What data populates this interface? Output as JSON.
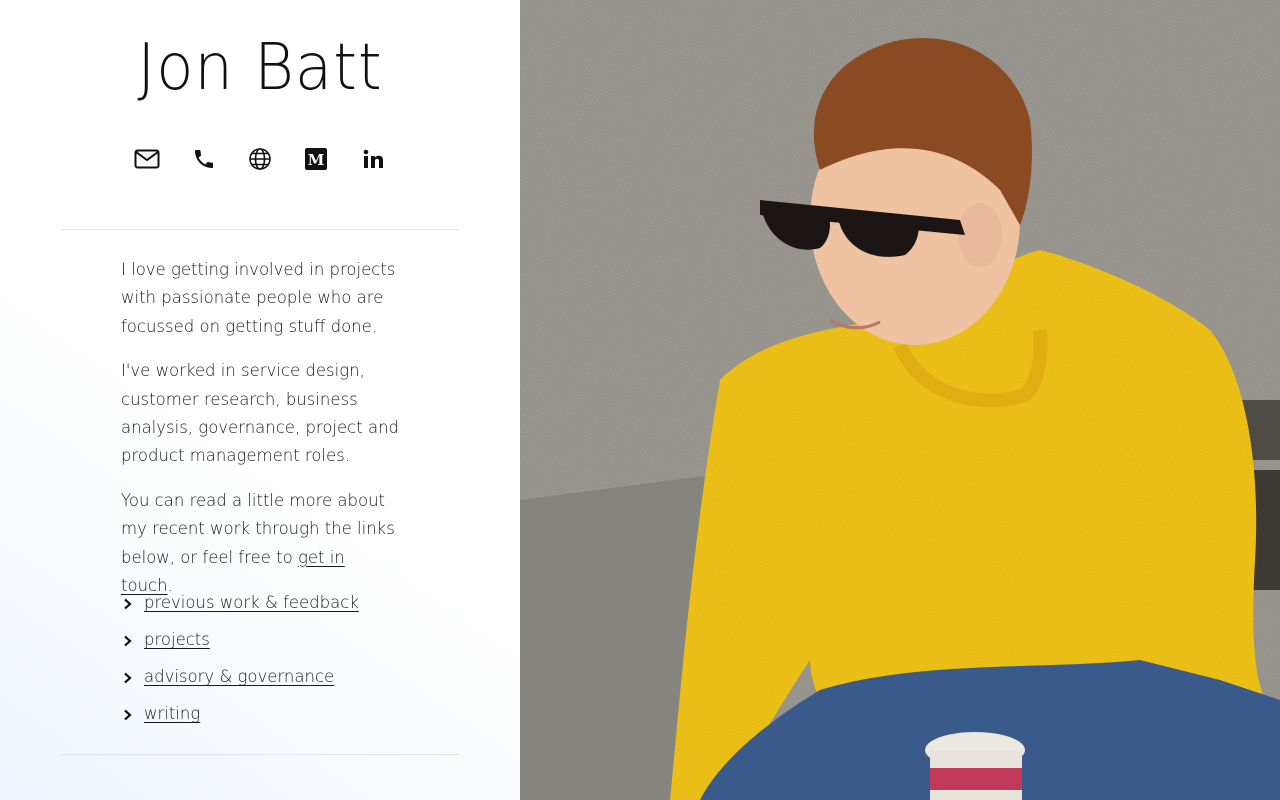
{
  "name": "Jon Batt",
  "contact_icons": [
    "email-icon",
    "phone-icon",
    "globe-icon",
    "medium-icon",
    "linkedin-icon"
  ],
  "bio": {
    "p1": "I love getting involved in projects with passionate people who are focussed on getting stuff done.",
    "p2": "I've worked in service design, customer research, business analysis, governance, project and product management roles.",
    "p3_text": "You can read a little more about my recent work through the links below, or feel free to ",
    "p3_link": "get in touch",
    "p3_end": "."
  },
  "links": [
    {
      "label": "previous work & feedback"
    },
    {
      "label": "projects"
    },
    {
      "label": "advisory & governance"
    },
    {
      "label": "writing"
    }
  ],
  "colors": {
    "sweater": "#f2c21c",
    "wall": "#8a8780",
    "jeans": "#3a5a8c",
    "hair": "#8a4a22"
  }
}
